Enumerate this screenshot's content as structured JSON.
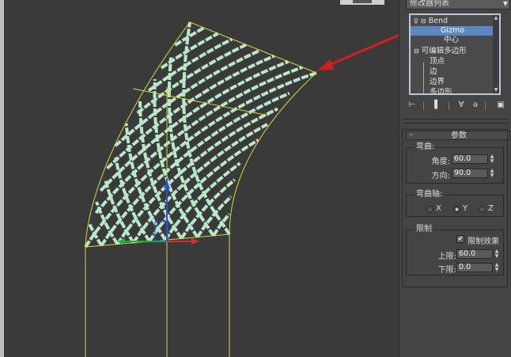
{
  "modifier_list": {
    "label": "修改器列表"
  },
  "stack": {
    "items": [
      {
        "label": "Bend",
        "selected": false
      },
      {
        "label": "Gizmo",
        "selected": true
      },
      {
        "label": "中心",
        "selected": false
      },
      {
        "label": "可编辑多边形",
        "selected": false
      },
      {
        "label": "顶点",
        "selected": false
      },
      {
        "label": "边",
        "selected": false
      },
      {
        "label": "边界",
        "selected": false
      },
      {
        "label": "多边形",
        "selected": false
      }
    ]
  },
  "params": {
    "title": "参数",
    "bend_group": "弯曲:",
    "angle_label": "角度:",
    "angle_value": "60.0",
    "direction_label": "方向:",
    "direction_value": "90.0",
    "axis_group": "弯曲轴:",
    "axis_options": [
      "X",
      "Y",
      "Z"
    ],
    "axis_selected": "Y",
    "limit_group": "限制",
    "limit_effect_label": "限制效果",
    "limit_effect_checked": true,
    "upper_label": "上限:",
    "upper_value": "60.0",
    "lower_label": "下限:",
    "lower_value": "0.0"
  },
  "colors": {
    "viewport_bg": "#3a3a3a",
    "mesh": "#b9e8c8",
    "gizmo": "#d8d840",
    "arrow": "#d21e1e",
    "selection": "#5b88c4"
  }
}
